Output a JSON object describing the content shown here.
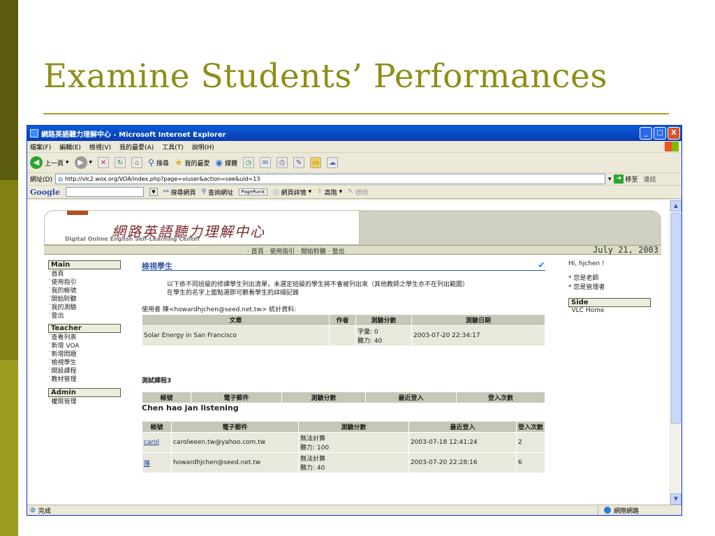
{
  "slide": {
    "title": "Examine Students’ Performances",
    "colors": {
      "accent": "#8e8e18",
      "bar_dark": "#5c5c0e",
      "bar_mid": "#808013",
      "bar_light": "#9c9c20"
    }
  },
  "window": {
    "title": "網路英語聽力理解中心 - Microsoft Internet Explorer",
    "buttons": {
      "minimize": "_",
      "maximize": "□",
      "close": "X"
    }
  },
  "menubar": [
    "檔案(F)",
    "編輯(E)",
    "檢視(V)",
    "我的最愛(A)",
    "工具(T)",
    "說明(H)"
  ],
  "toolbar": {
    "back": "上一頁",
    "search": "搜尋",
    "favorites": "我的最愛",
    "media": "媒體"
  },
  "addressbar": {
    "label": "網址(D)",
    "url": "http://vlc2.wox.org/VOA/index.php?page=viuser&action=see&uid=13",
    "go": "移至",
    "links": "連結"
  },
  "googlebar": {
    "logo": "Google",
    "search_web": "搜尋網頁",
    "search_site": "查詢網址",
    "pagerank": "PageRank",
    "page_info": "網頁詳情",
    "up": "高階",
    "highlight": "標明"
  },
  "banner": {
    "title_cn": "網路英語聽力理解中心",
    "title_en": "Digital Online English Self-Learning Center"
  },
  "nav": {
    "links": "· 首頁 · 使用指引 · 開始聆聽 · 登出",
    "date": "July 21, 2003"
  },
  "leftnav": {
    "main_head": "Main",
    "main_items": [
      "˙首頁",
      "˙使用指引",
      "˙我的帳號",
      "˙開始聆聽",
      "˙我的測驗",
      "˙登出"
    ],
    "teacher_head": "Teacher",
    "teacher_items": [
      "˙查看列表",
      "˙新增 VOA",
      "˙新增問題",
      "˙檢視學生",
      "˙開設課程",
      "˙教材管理"
    ],
    "admin_head": "Admin",
    "admin_items": [
      "˙權限管理"
    ]
  },
  "main": {
    "title": "檢視學生",
    "desc1": "以下依不同班級的修課學生列出清單，未選定班級的學生將不會被列出來（其他教師之學生亦不在列出範圍）",
    "desc2": "在學生的名字上面點選即可觀看學生的詳細記錄",
    "stats_line": "使用者 陳<howardhjchen@seed.net.tw> 統計資料:",
    "stats_headers": [
      "文章",
      "作者",
      "測驗分數",
      "測驗日期"
    ],
    "stats_rows": [
      {
        "article": "Solar Energy in San Francisco",
        "author": "",
        "score1": "字彙: 0",
        "score2": "聽力: 40",
        "date": "2003-07-20 22:34:17"
      }
    ],
    "course1_label": "測試課程3",
    "course_headers": [
      "帳號",
      "電子郵件",
      "測驗分數",
      "最近登入",
      "登入次數"
    ],
    "course2_label": "Chen hao jan listening",
    "students": [
      {
        "account": "carol",
        "email": "carolween.tw@yahoo.com.tw",
        "score1": "無法計算",
        "score2": "聽力: 100",
        "last_login": "2003-07-18 12:41:24",
        "count": "2"
      },
      {
        "account": "陳",
        "email": "howardhjchen@seed.net.tw",
        "score1": "無法計算",
        "score2": "聽力: 40",
        "last_login": "2003-07-20 22:28:16",
        "count": "6"
      }
    ]
  },
  "rightside": {
    "greeting": "Hi, hjchen !",
    "items": [
      "* 您是老師",
      "* 您是管理者"
    ],
    "side_head": "Side",
    "side_link": "˙VLC Home"
  },
  "statusbar": {
    "status": "完成",
    "zone": "網際網路"
  }
}
